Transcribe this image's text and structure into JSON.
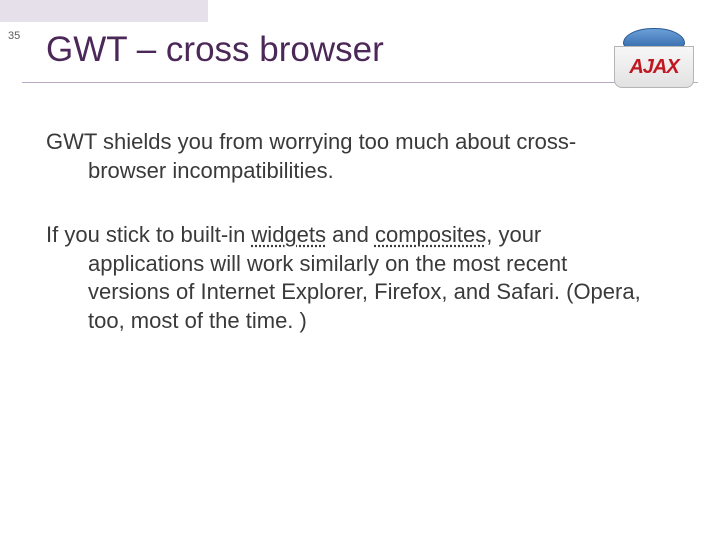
{
  "slideNumber": "35",
  "title": "GWT – cross browser",
  "logo": {
    "label": "AJAX"
  },
  "body": {
    "para1": "GWT shields you from worrying too much about cross-browser incompatibilities.",
    "para2_pre": "If you stick to built-in ",
    "para2_link1": "widgets",
    "para2_mid": " and ",
    "para2_link2": "composites",
    "para2_post": ", your applications will work similarly on the most recent versions of Internet Explorer, Firefox, and Safari. (Opera, too, most of the time. )"
  }
}
